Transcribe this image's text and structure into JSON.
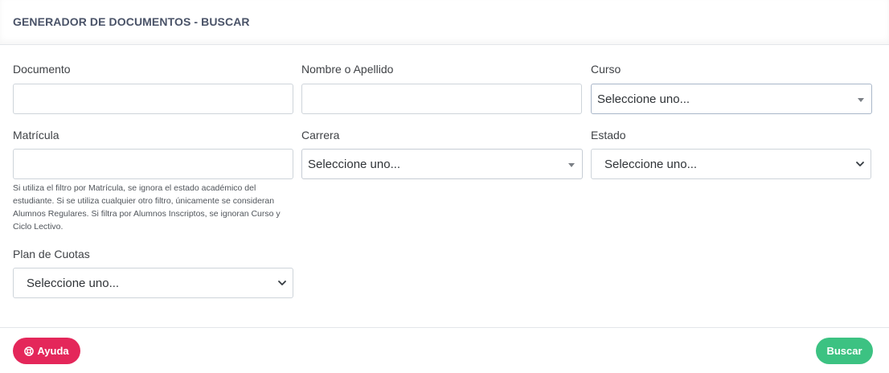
{
  "header": {
    "title": "GENERADOR DE DOCUMENTOS - BUSCAR"
  },
  "fields": {
    "documento": {
      "label": "Documento",
      "value": ""
    },
    "nombre": {
      "label": "Nombre o Apellido",
      "value": ""
    },
    "curso": {
      "label": "Curso",
      "selected": "Seleccione uno..."
    },
    "matricula": {
      "label": "Matrícula",
      "value": "",
      "help": "Si utiliza el filtro por Matrícula, se ignora el estado académico del estudiante. Si se utiliza cualquier otro filtro, únicamente se consideran Alumnos Regulares. Si filtra por Alumnos Inscriptos, se ignoran Curso y Ciclo Lectivo."
    },
    "carrera": {
      "label": "Carrera",
      "selected": "Seleccione uno..."
    },
    "estado": {
      "label": "Estado",
      "selected": "Seleccione uno..."
    },
    "plan_cuotas": {
      "label": "Plan de Cuotas",
      "selected": "Seleccione uno..."
    }
  },
  "footer": {
    "help_label": "Ayuda",
    "search_label": "Buscar"
  },
  "colors": {
    "help_button": "#e4275a",
    "search_button": "#3cc282",
    "title": "#4a5368"
  },
  "icons": {
    "help": "lifebuoy-icon",
    "select_caret": "caret-down-icon",
    "select_chevron": "chevron-down-icon"
  }
}
